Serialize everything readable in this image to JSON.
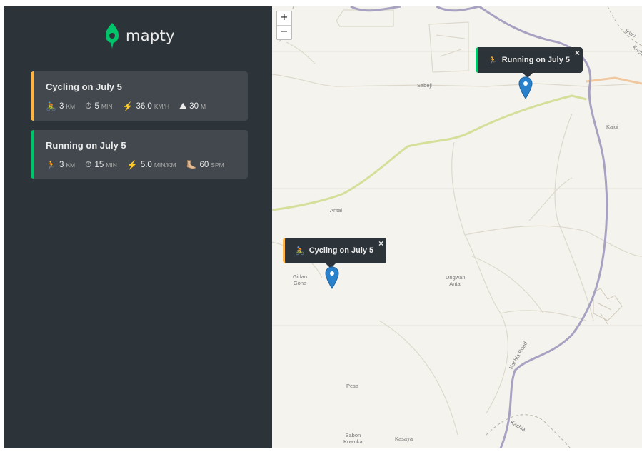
{
  "app": {
    "name": "mapty"
  },
  "colors": {
    "sidebar": "#2d3439",
    "card": "#42484d",
    "cycling": "#ffb545",
    "running": "#00c46a",
    "brand": "#00c46a",
    "marker": "#2a81cb"
  },
  "workouts": [
    {
      "type": "cycling",
      "title": "Cycling on July 5",
      "details": [
        {
          "icon": "🚴",
          "value": "3",
          "unit": "km"
        },
        {
          "icon": "⏱",
          "value": "5",
          "unit": "min"
        },
        {
          "icon": "⚡️",
          "value": "36.0",
          "unit": "km/h"
        },
        {
          "icon": "⛰",
          "value": "30",
          "unit": "m"
        }
      ]
    },
    {
      "type": "running",
      "title": "Running on July 5",
      "details": [
        {
          "icon": "🏃",
          "value": "3",
          "unit": "km"
        },
        {
          "icon": "⏱",
          "value": "15",
          "unit": "min"
        },
        {
          "icon": "⚡️",
          "value": "5.0",
          "unit": "min/km"
        },
        {
          "icon": "🦶🏼",
          "value": "60",
          "unit": "spm"
        }
      ]
    }
  ],
  "map": {
    "zoom_in": "+",
    "zoom_out": "−",
    "popups": [
      {
        "icon": "🏃",
        "label": "Running on July 5",
        "close": "×"
      },
      {
        "icon": "🚴",
        "label": "Cycling on July 5",
        "close": "×"
      }
    ],
    "labels": {
      "sabeji": "Sabeji",
      "kajui": "Kajui",
      "antai": "Antai",
      "gidan": "Gidan",
      "gona": "Gona",
      "ungwan": "Ungwan",
      "antai2": "Antai",
      "pesa": "Pesa",
      "sabon": "Sabon",
      "kowuka": "Kowuka",
      "kasaya": "Kasaya",
      "kachia_road": "Kachia Road",
      "kachia": "Kachia",
      "ikulu": "Ikulu",
      "kach": "Kach"
    }
  }
}
